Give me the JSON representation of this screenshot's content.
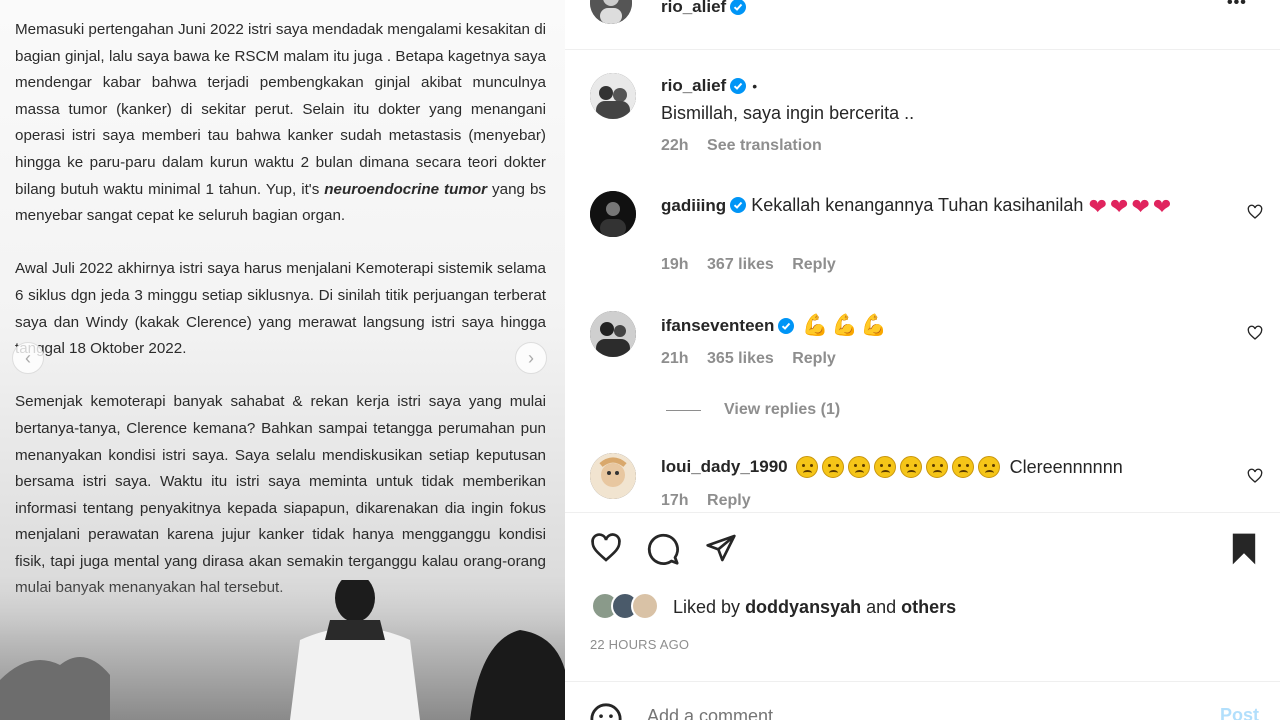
{
  "post_image": {
    "paragraphs": [
      {
        "before": "Memasuki pertengahan Juni 2022 istri saya mendadak mengalami kesakitan di bagian ginjal, lalu saya bawa ke RSCM malam itu juga . Betapa kagetnya saya mendengar kabar bahwa terjadi pembengkakan ginjal akibat munculnya massa tumor (kanker) di sekitar perut. Selain itu dokter yang menangani operasi istri saya memberi tau bahwa kanker sudah metastasis (menyebar) hingga ke paru-paru dalam kurun waktu 2 bulan dimana secara teori dokter bilang butuh waktu minimal 1 tahun. Yup, it's ",
        "emphasis": "neuroendocrine tumor",
        "after": " yang bs menyebar sangat cepat ke seluruh bagian organ."
      },
      {
        "before": "Awal Juli 2022 akhirnya istri saya harus menjalani Kemoterapi sistemik selama 6 siklus dgn jeda 3 minggu setiap siklusnya. Di sinilah titik perjuangan terberat saya dan Windy (kakak Clerence) yang merawat langsung istri saya hingga tanggal 18 Oktober 2022.",
        "emphasis": "",
        "after": ""
      },
      {
        "before": "Semenjak kemoterapi banyak sahabat & rekan kerja istri saya yang mulai bertanya-tanya, Clerence kemana? Bahkan sampai tetangga perumahan pun menanyakan kondisi istri saya. Saya selalu mendiskusikan setiap keputusan bersama istri saya. Waktu itu istri saya meminta untuk tidak memberikan informasi tentang penyakitnya kepada siapapun, dikarenakan dia ingin fokus menjalani perawatan karena jujur kanker tidak hanya mengganggu kondisi fisik, tapi juga mental yang dirasa akan semakin terganggu kalau orang-orang mulai banyak menanyakan hal tersebut.",
        "emphasis": "",
        "after": ""
      }
    ]
  },
  "header": {
    "username": "rio_alief",
    "more": "•••"
  },
  "caption": {
    "username": "rio_alief",
    "dot": "•",
    "text": "Bismillah, saya ingin bercerita ..",
    "time": "22h",
    "translate": "See translation"
  },
  "comments": [
    {
      "username": "gadiiing",
      "text": "Kekallah kenangannya Tuhan kasihanilah",
      "time": "19h",
      "likes": "367 likes",
      "reply": "Reply"
    },
    {
      "username": "ifanseventeen",
      "text": "",
      "time": "21h",
      "likes": "365 likes",
      "reply": "Reply",
      "view_replies": "View replies (1)"
    },
    {
      "username": "loui_dady_1990",
      "text": "Clereennnnnn",
      "time": "17h",
      "reply": "Reply"
    }
  ],
  "actions": {
    "liked_by_prefix": "Liked by",
    "liked_by_user": "doddyansyah",
    "liked_by_and": "and",
    "liked_by_others": "others",
    "timestamp": "22 HOURS AGO"
  },
  "comment_box": {
    "placeholder": "Add a comment...",
    "post_label": "Post"
  },
  "colors": {
    "verified": "#0095f6",
    "heart": "#e0245e",
    "muted": "#8e8e8e",
    "post_disabled": "#b2dffc"
  },
  "icons": [
    "heart-icon",
    "comment-icon",
    "share-icon",
    "bookmark-icon",
    "emoji-icon",
    "verified-badge-icon",
    "more-icon"
  ]
}
